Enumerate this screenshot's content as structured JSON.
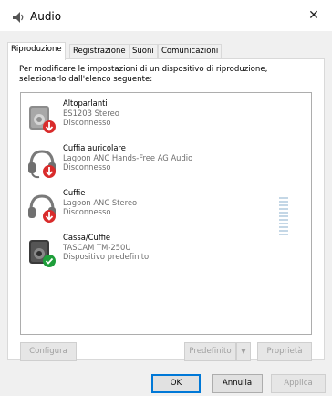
{
  "window": {
    "title": "Audio",
    "close_glyph": "✕"
  },
  "tabs": [
    {
      "label": "Riproduzione"
    },
    {
      "label": "Registrazione"
    },
    {
      "label": "Suoni"
    },
    {
      "label": "Comunicazioni"
    }
  ],
  "instructions": {
    "line1": "Per modificare le impostazioni di un dispositivo di riproduzione,",
    "line2": "selezionarlo dall'elenco seguente:"
  },
  "devices": [
    {
      "name": "Altoparlanti",
      "model": "ES1203 Stereo",
      "status": "Disconnesso",
      "icon": "speaker-icon",
      "badge": "disconnected-badge-icon"
    },
    {
      "name": "Cuffia auricolare",
      "model": "Lagoon ANC  Hands-Free AG Audio",
      "status": "Disconnesso",
      "icon": "headset-icon",
      "badge": "disconnected-badge-icon"
    },
    {
      "name": "Cuffie",
      "model": "Lagoon ANC  Stereo",
      "status": "Disconnesso",
      "icon": "headphones-icon",
      "badge": "disconnected-badge-icon"
    },
    {
      "name": "Cassa/Cuffie",
      "model": "TASCAM TM-250U",
      "status": "Dispositivo predefinito",
      "icon": "speaker-icon",
      "badge": "default-check-icon"
    }
  ],
  "buttons": {
    "configure": "Configura",
    "default": "Predefinito",
    "default_arrow": "▼",
    "properties": "Proprietà",
    "ok": "OK",
    "cancel": "Annulla",
    "apply": "Applica"
  },
  "colors": {
    "disconnected_badge": "#d92b2b",
    "default_badge": "#1e9e3a",
    "accent": "#0078d7"
  }
}
